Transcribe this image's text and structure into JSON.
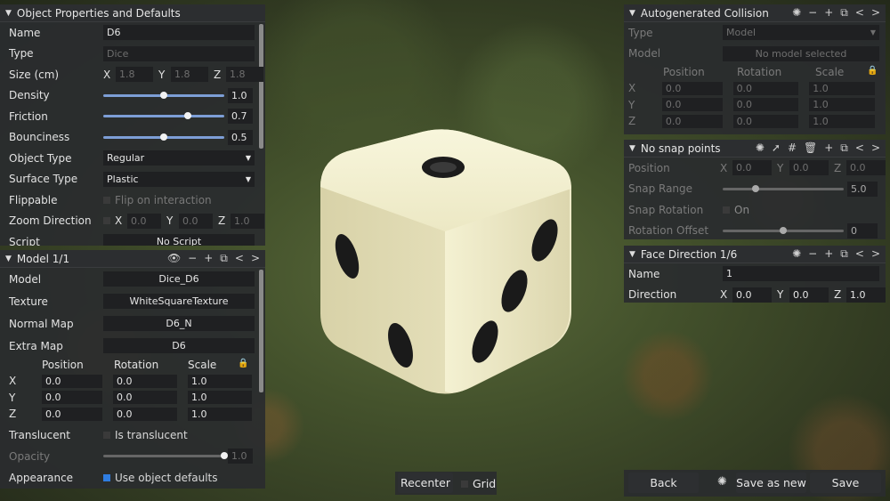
{
  "props": {
    "title": "Object Properties and Defaults",
    "name_label": "Name",
    "name_value": "D6",
    "type_label": "Type",
    "type_value": "Dice",
    "size_label": "Size (cm)",
    "size": {
      "x": "1.8",
      "y": "1.8",
      "z": "1.8"
    },
    "density_label": "Density",
    "density_value": "1.0",
    "density_fraction": 0.5,
    "friction_label": "Friction",
    "friction_value": "0.7",
    "friction_fraction": 0.7,
    "bounciness_label": "Bounciness",
    "bounciness_value": "0.5",
    "bounciness_fraction": 0.5,
    "objtype_label": "Object Type",
    "objtype_value": "Regular",
    "surface_label": "Surface Type",
    "surface_value": "Plastic",
    "flippable_label": "Flippable",
    "flippable_check": "Flip on interaction",
    "zoom_label": "Zoom Direction",
    "zoom": {
      "x": "0.0",
      "y": "0.0",
      "z": "1.0"
    },
    "script_label": "Script",
    "script_value": "No Script"
  },
  "model": {
    "title": "Model 1/1",
    "model_label": "Model",
    "model_value": "Dice_D6",
    "texture_label": "Texture",
    "texture_value": "WhiteSquareTexture",
    "normal_label": "Normal Map",
    "normal_value": "D6_N",
    "extra_label": "Extra Map",
    "extra_value": "D6",
    "col_position": "Position",
    "col_rotation": "Rotation",
    "col_scale": "Scale",
    "rows": [
      {
        "axis": "X",
        "pos": "0.0",
        "rot": "0.0",
        "scale": "1.0"
      },
      {
        "axis": "Y",
        "pos": "0.0",
        "rot": "0.0",
        "scale": "1.0"
      },
      {
        "axis": "Z",
        "pos": "0.0",
        "rot": "0.0",
        "scale": "1.0"
      }
    ],
    "translucent_label": "Translucent",
    "translucent_check": "Is translucent",
    "opacity_label": "Opacity",
    "opacity_value": "1.0",
    "opacity_fraction": 1.0,
    "appearance_label": "Appearance",
    "appearance_check": "Use object defaults"
  },
  "collision": {
    "title": "Autogenerated Collision",
    "type_label": "Type",
    "type_value": "Model",
    "model_label": "Model",
    "model_value": "No model selected",
    "col_position": "Position",
    "col_rotation": "Rotation",
    "col_scale": "Scale",
    "rows": [
      {
        "axis": "X",
        "pos": "0.0",
        "rot": "0.0",
        "scale": "1.0"
      },
      {
        "axis": "Y",
        "pos": "0.0",
        "rot": "0.0",
        "scale": "1.0"
      },
      {
        "axis": "Z",
        "pos": "0.0",
        "rot": "0.0",
        "scale": "1.0"
      }
    ]
  },
  "snap": {
    "title": "No snap points",
    "position_label": "Position",
    "position": {
      "x": "0.0",
      "y": "0.0",
      "z": "0.0"
    },
    "range_label": "Snap Range",
    "range_value": "5.0",
    "range_fraction": 0.27,
    "rotation_label": "Snap Rotation",
    "rotation_check": "On",
    "offset_label": "Rotation Offset",
    "offset_value": "0",
    "offset_fraction": 0.5
  },
  "face": {
    "title": "Face Direction 1/6",
    "name_label": "Name",
    "name_value": "1",
    "direction_label": "Direction",
    "direction": {
      "x": "0.0",
      "y": "0.0",
      "z": "1.0"
    }
  },
  "bottom": {
    "recenter": "Recenter",
    "grid": "Grid",
    "back": "Back",
    "save_new": "Save as new",
    "save": "Save"
  }
}
